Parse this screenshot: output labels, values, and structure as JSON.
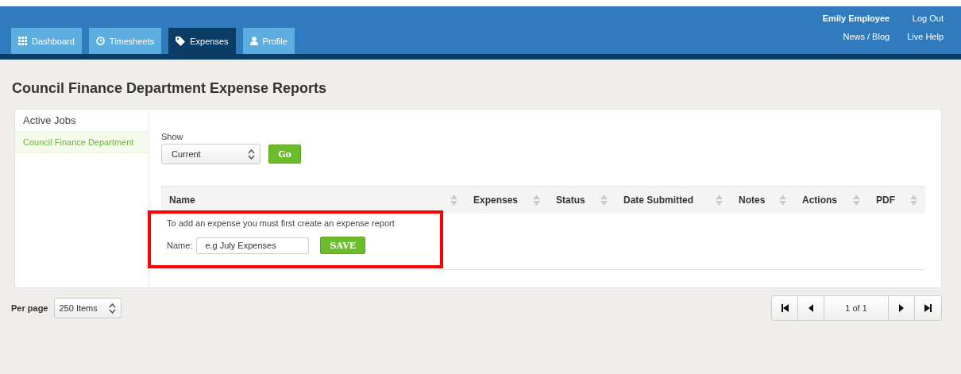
{
  "nav": {
    "tabs": [
      {
        "label": "Dashboard",
        "kind": "grid",
        "selected": false
      },
      {
        "label": "Timesheets",
        "kind": "clock",
        "selected": false
      },
      {
        "label": "Expenses",
        "kind": "tag",
        "selected": true
      },
      {
        "label": "Profile",
        "kind": "user",
        "selected": false
      }
    ],
    "user_name": "Emily Employee",
    "links": [
      "Log Out",
      "News / Blog",
      "Live Help"
    ]
  },
  "page_title": "Council Finance Department Expense Reports",
  "sidebar": {
    "heading": "Active Jobs",
    "items": [
      {
        "label": "Council Finance Department",
        "selected": true
      }
    ]
  },
  "filter": {
    "label": "Show",
    "value": "Current",
    "button": "Go"
  },
  "table": {
    "columns": [
      "Name",
      "Expenses",
      "Status",
      "Date Submitted",
      "Notes",
      "Actions",
      "PDF"
    ]
  },
  "add_report": {
    "highlighted": true,
    "message": "To add an expense you must first create an expense report",
    "label": "Name:",
    "placeholder": "e.g July Expenses",
    "button": "SAVE"
  },
  "per_page": {
    "label": "Per page",
    "value": "250 Items"
  },
  "pagination": {
    "page": "1 of 1"
  }
}
